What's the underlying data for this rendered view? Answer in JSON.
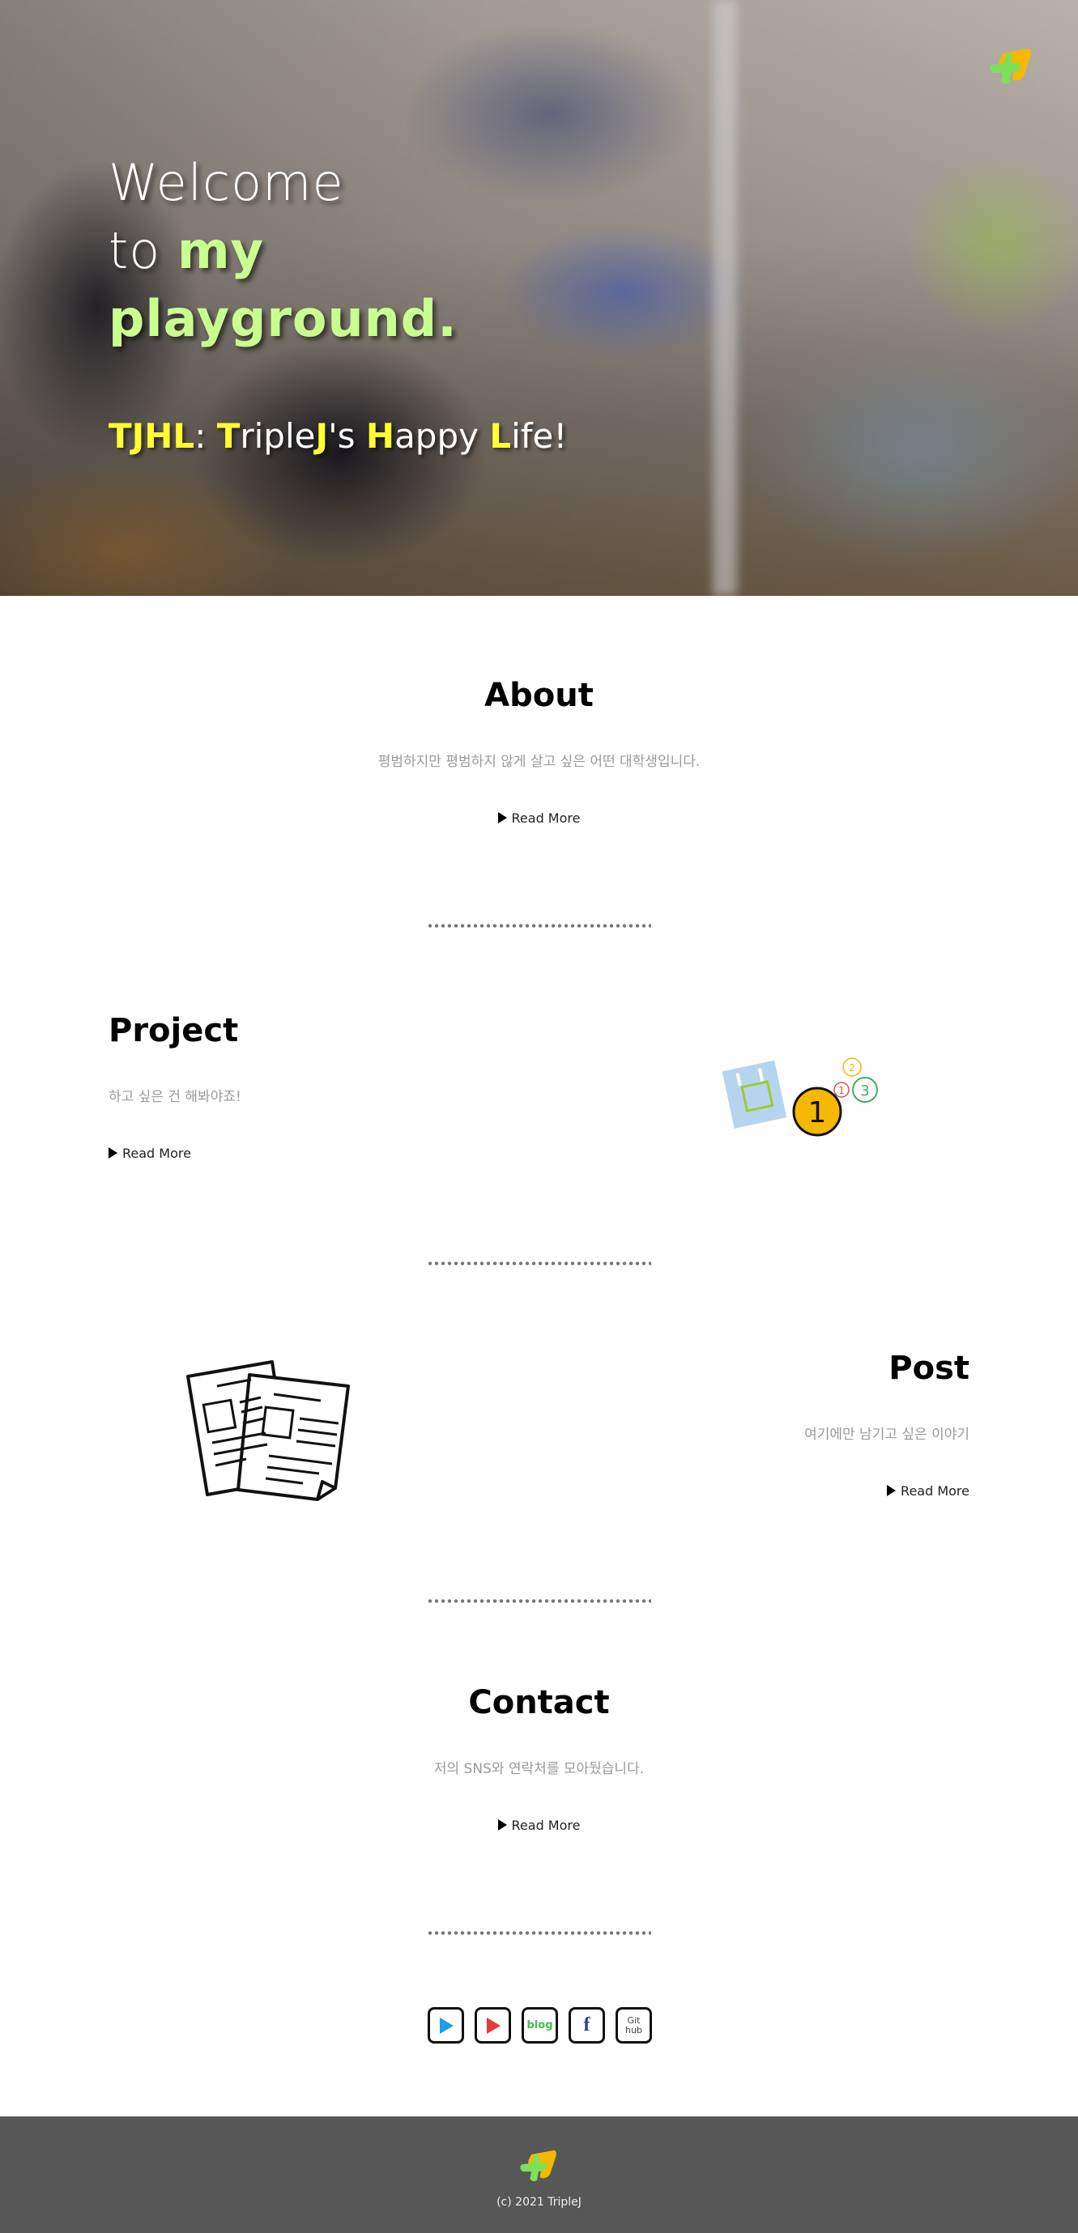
{
  "hero": {
    "title_line1": "Welcome",
    "title_line2_a": "to ",
    "title_line2_b": "my",
    "title_line3": "playground.",
    "subtitle": {
      "t1": "TJHL",
      "t2": ": ",
      "t3": "T",
      "t4": "riple",
      "t5": "J",
      "t6": "'s ",
      "t7": "H",
      "t8": "appy ",
      "t9": "L",
      "t10": "ife!"
    },
    "logo_icon": "tj-logo-icon"
  },
  "about": {
    "title": "About",
    "description": "평범하지만 평범하지 않게 살고 싶은 어떤 대학생입니다.",
    "read_more": "Read More"
  },
  "project": {
    "title": "Project",
    "description": "하고 싶은 건 해봐야죠!",
    "read_more": "Read More",
    "illustration_icon": "project-steps-icon",
    "illustration_numbers": [
      "1",
      "2",
      "3"
    ]
  },
  "post": {
    "title": "Post",
    "description": "여기에만 남기고 싶은 이야기",
    "read_more": "Read More",
    "illustration_icon": "documents-icon"
  },
  "contact": {
    "title": "Contact",
    "description": "저의 SNS와 연락처를 모아뒀습니다.",
    "read_more": "Read More"
  },
  "social": [
    {
      "name": "play-icon",
      "label": ""
    },
    {
      "name": "youtube-icon",
      "label": ""
    },
    {
      "name": "blog-icon",
      "label": "blog"
    },
    {
      "name": "facebook-icon",
      "label": "f"
    },
    {
      "name": "github-icon",
      "label_line1": "Git",
      "label_line2": "hub"
    }
  ],
  "footer": {
    "copyright": "(c) 2021 TripleJ",
    "logo_icon": "tj-logo-icon"
  },
  "colors": {
    "hero_highlight": "#c9ff8f",
    "hero_letter_highlight": "#ffff33",
    "description_gray": "#9a9a9a",
    "footer_bg": "#575757",
    "play_blue": "#1a9fe0",
    "youtube_red": "#e53935",
    "blog_green": "#3fbf4f",
    "facebook_blue": "#2a3c8f"
  }
}
